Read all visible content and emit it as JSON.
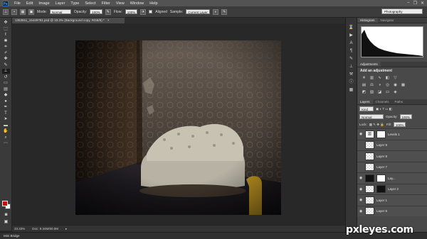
{
  "app": {
    "logo": "Ps"
  },
  "menu": [
    "File",
    "Edit",
    "Image",
    "Layer",
    "Type",
    "Select",
    "Filter",
    "View",
    "Window",
    "Help"
  ],
  "window_controls": [
    "–",
    "❐",
    "✕"
  ],
  "options_bar": {
    "mode_label": "Mode:",
    "mode_value": "Normal",
    "opacity_label": "Opacity:",
    "opacity_value": "100%",
    "flow_label": "Flow:",
    "flow_value": "100%",
    "aligned_label": "Aligned",
    "sample_label": "Sample:",
    "sample_value": "Current Layer"
  },
  "workspace": "Photography",
  "document_tab": {
    "title": "1353811_15449781.psd @ 33.3% (Background copy, RGB/8) *",
    "close": "×"
  },
  "status": {
    "zoom": "33.33%",
    "doc": "Doc: 9.34M/60.0M"
  },
  "mini_bridge": "Mini Bridge",
  "panels": {
    "histogram_tabs": [
      "Histogram",
      "Navigator"
    ],
    "adjustments_tab": "Adjustments",
    "adjustments_title": "Add an adjustment",
    "layers_tabs": [
      "Layers",
      "Channels",
      "Paths"
    ],
    "kind": "Kind",
    "blend_mode": "Normal",
    "opacity_label": "Opacity:",
    "opacity_value": "100%",
    "lock_label": "Lock:",
    "fill_label": "Fill:",
    "fill_value": "100%",
    "layers": [
      "Levels 1",
      "Layer 9",
      "Layer 8",
      "Layer 7",
      "Lay...",
      "Layer 2",
      "Layer 1",
      "Layer 6"
    ]
  },
  "watermark": "pxleyes.com",
  "colors": {
    "foreground": "#c80c0c",
    "background": "#ffffff",
    "accent": "#0a1f3a"
  }
}
